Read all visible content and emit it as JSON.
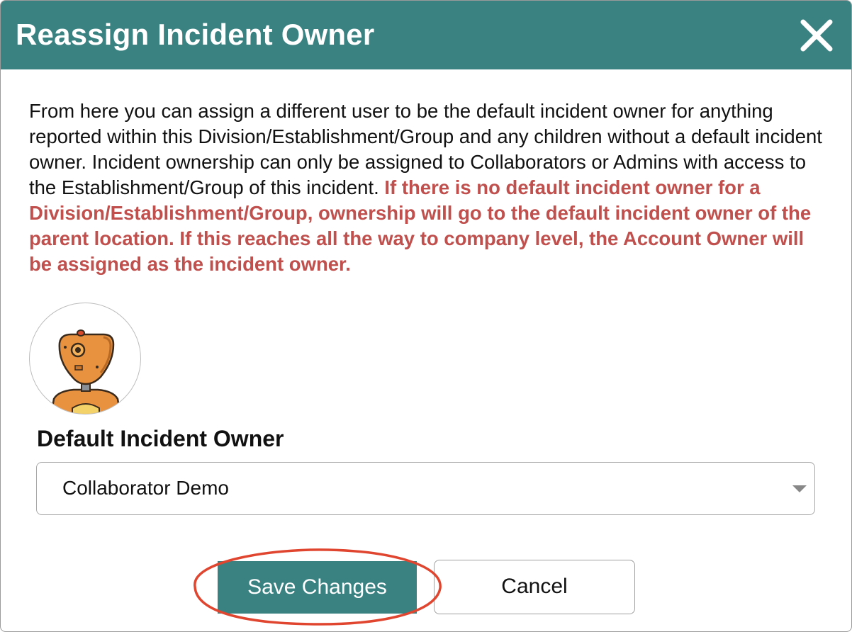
{
  "dialog": {
    "title": "Reassign Incident Owner",
    "close_icon": "close-icon"
  },
  "description": {
    "text": "From here you can assign a different user to be the default incident owner for anything reported within this Division/Establishment/Group and any children without a default incident owner. Incident ownership can only be assigned to Collaborators or Admins with access to the Establishment/Group of this incident.",
    "warning": "If there is no default incident owner for a Division/Establishment/Group, ownership will go to the default incident owner of the parent location. If this reaches all the way to company level, the Account Owner will be assigned as the incident owner."
  },
  "avatar": {
    "icon": "robot-avatar-icon"
  },
  "owner_field": {
    "label": "Default Incident Owner",
    "selected_value": "Collaborator Demo",
    "caret_icon": "chevron-down-icon"
  },
  "actions": {
    "save_label": "Save Changes",
    "cancel_label": "Cancel"
  },
  "colors": {
    "header": "#3a8282",
    "primary_button": "#3a8282",
    "warning_text": "#c0504d",
    "annotation_circle": "#e0452f"
  }
}
